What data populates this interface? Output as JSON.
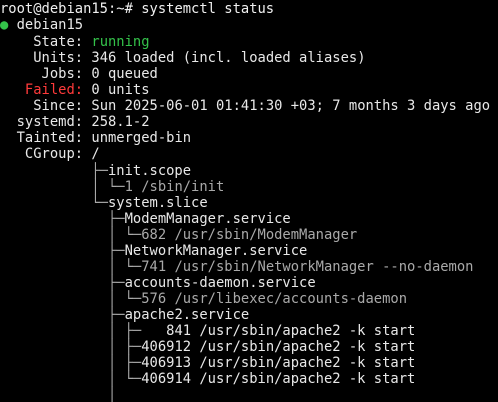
{
  "prompt": {
    "user_host_path": "root@debian15:~#",
    "command": " systemctl status"
  },
  "host": {
    "dot": "●",
    "name": "debian15"
  },
  "status": {
    "state_label": "    State:",
    "state_value": " running",
    "units_label": "    Units:",
    "units_value": " 346 loaded (incl. loaded aliases)",
    "jobs_label": "     Jobs:",
    "jobs_value": " 0 queued",
    "failed_label": "   Failed:",
    "failed_value": " 0 units",
    "since_label": "    Since:",
    "since_value": " Sun 2025-06-01 01:41:30 +03; 7 months 3 days ago",
    "systemd_label": "  systemd:",
    "systemd_value": " 258.1-2",
    "tainted_label": "  Tainted:",
    "tainted_value": " unmerged-bin",
    "cgroup_label": "   CGroup:",
    "cgroup_value": " /"
  },
  "tree": [
    {
      "prefix": "           ├─",
      "text": "init.scope",
      "dim": false
    },
    {
      "prefix": "           │ └─",
      "text": "1 /sbin/init",
      "dim": true
    },
    {
      "prefix": "           └─",
      "text": "system.slice",
      "dim": false
    },
    {
      "prefix": "             ├─",
      "text": "ModemManager.service",
      "dim": false
    },
    {
      "prefix": "             │ └─",
      "text": "682 /usr/sbin/ModemManager",
      "dim": true
    },
    {
      "prefix": "             ├─",
      "text": "NetworkManager.service",
      "dim": false
    },
    {
      "prefix": "             │ └─",
      "text": "741 /usr/sbin/NetworkManager --no-daemon",
      "dim": true
    },
    {
      "prefix": "             ├─",
      "text": "accounts-daemon.service",
      "dim": false
    },
    {
      "prefix": "             │ └─",
      "text": "576 /usr/libexec/accounts-daemon",
      "dim": true
    },
    {
      "prefix": "             ├─",
      "text": "apache2.service",
      "dim": false
    },
    {
      "prefix": "             │ ├─",
      "text": "   841 /usr/sbin/apache2 -k start",
      "dim": false
    },
    {
      "prefix": "             │ ├─",
      "text": "406912 /usr/sbin/apache2 -k start",
      "dim": false
    },
    {
      "prefix": "             │ ├─",
      "text": "406913 /usr/sbin/apache2 -k start",
      "dim": false
    },
    {
      "prefix": "             │ └─",
      "text": "406914 /usr/sbin/apache2 -k start",
      "dim": false
    },
    {
      "prefix": "             │",
      "text": "",
      "dim": false
    }
  ],
  "colors": {
    "background": "#000000",
    "foreground": "#e8e8e8",
    "running_green": "#34c24a",
    "failed_red": "#ff3a3a",
    "dim_gray": "#a9a9a9"
  }
}
